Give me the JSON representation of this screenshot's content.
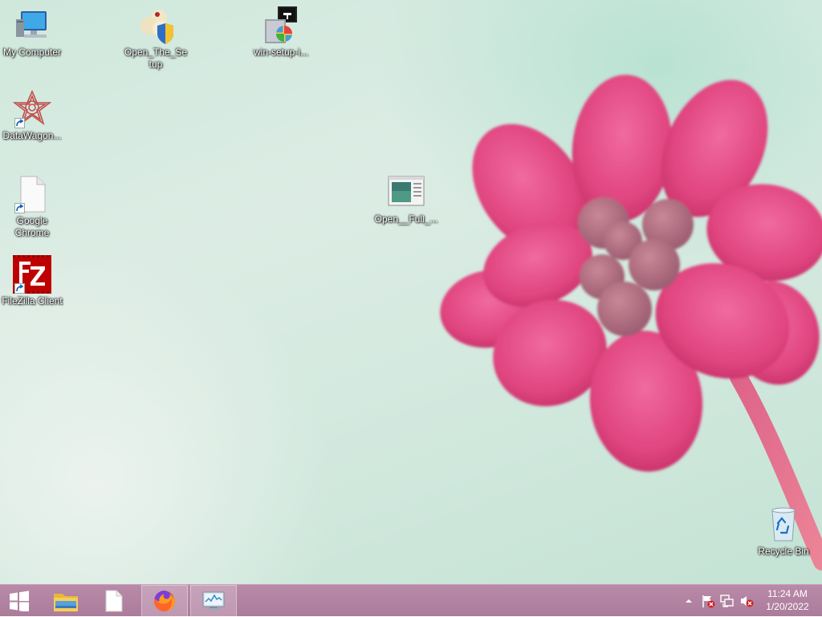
{
  "desktop": {
    "icons": [
      {
        "label": "My Computer"
      },
      {
        "label": "Open_The_Setup"
      },
      {
        "label": "win-setup-i..."
      },
      {
        "label": "DataWagon..."
      },
      {
        "label": "Google Chrome"
      },
      {
        "label": "Open__Full_..."
      },
      {
        "label": "FileZilla Client"
      },
      {
        "label": "Recycle Bin"
      }
    ]
  },
  "taskbar": {
    "pinned": [
      "start-icon",
      "file-explorer-icon",
      "blank-document-icon",
      "firefox-icon",
      "task-manager-icon"
    ],
    "tray_icons": [
      "show-hidden-icons-chevron",
      "action-center-flag-icon",
      "network-icon",
      "volume-muted-icon"
    ],
    "clock": {
      "time": "11:24 AM",
      "date": "1/20/2022"
    }
  },
  "colors": {
    "taskbar": "#b07f9e",
    "petal": "#e0457f",
    "background": "#d4e9df"
  }
}
